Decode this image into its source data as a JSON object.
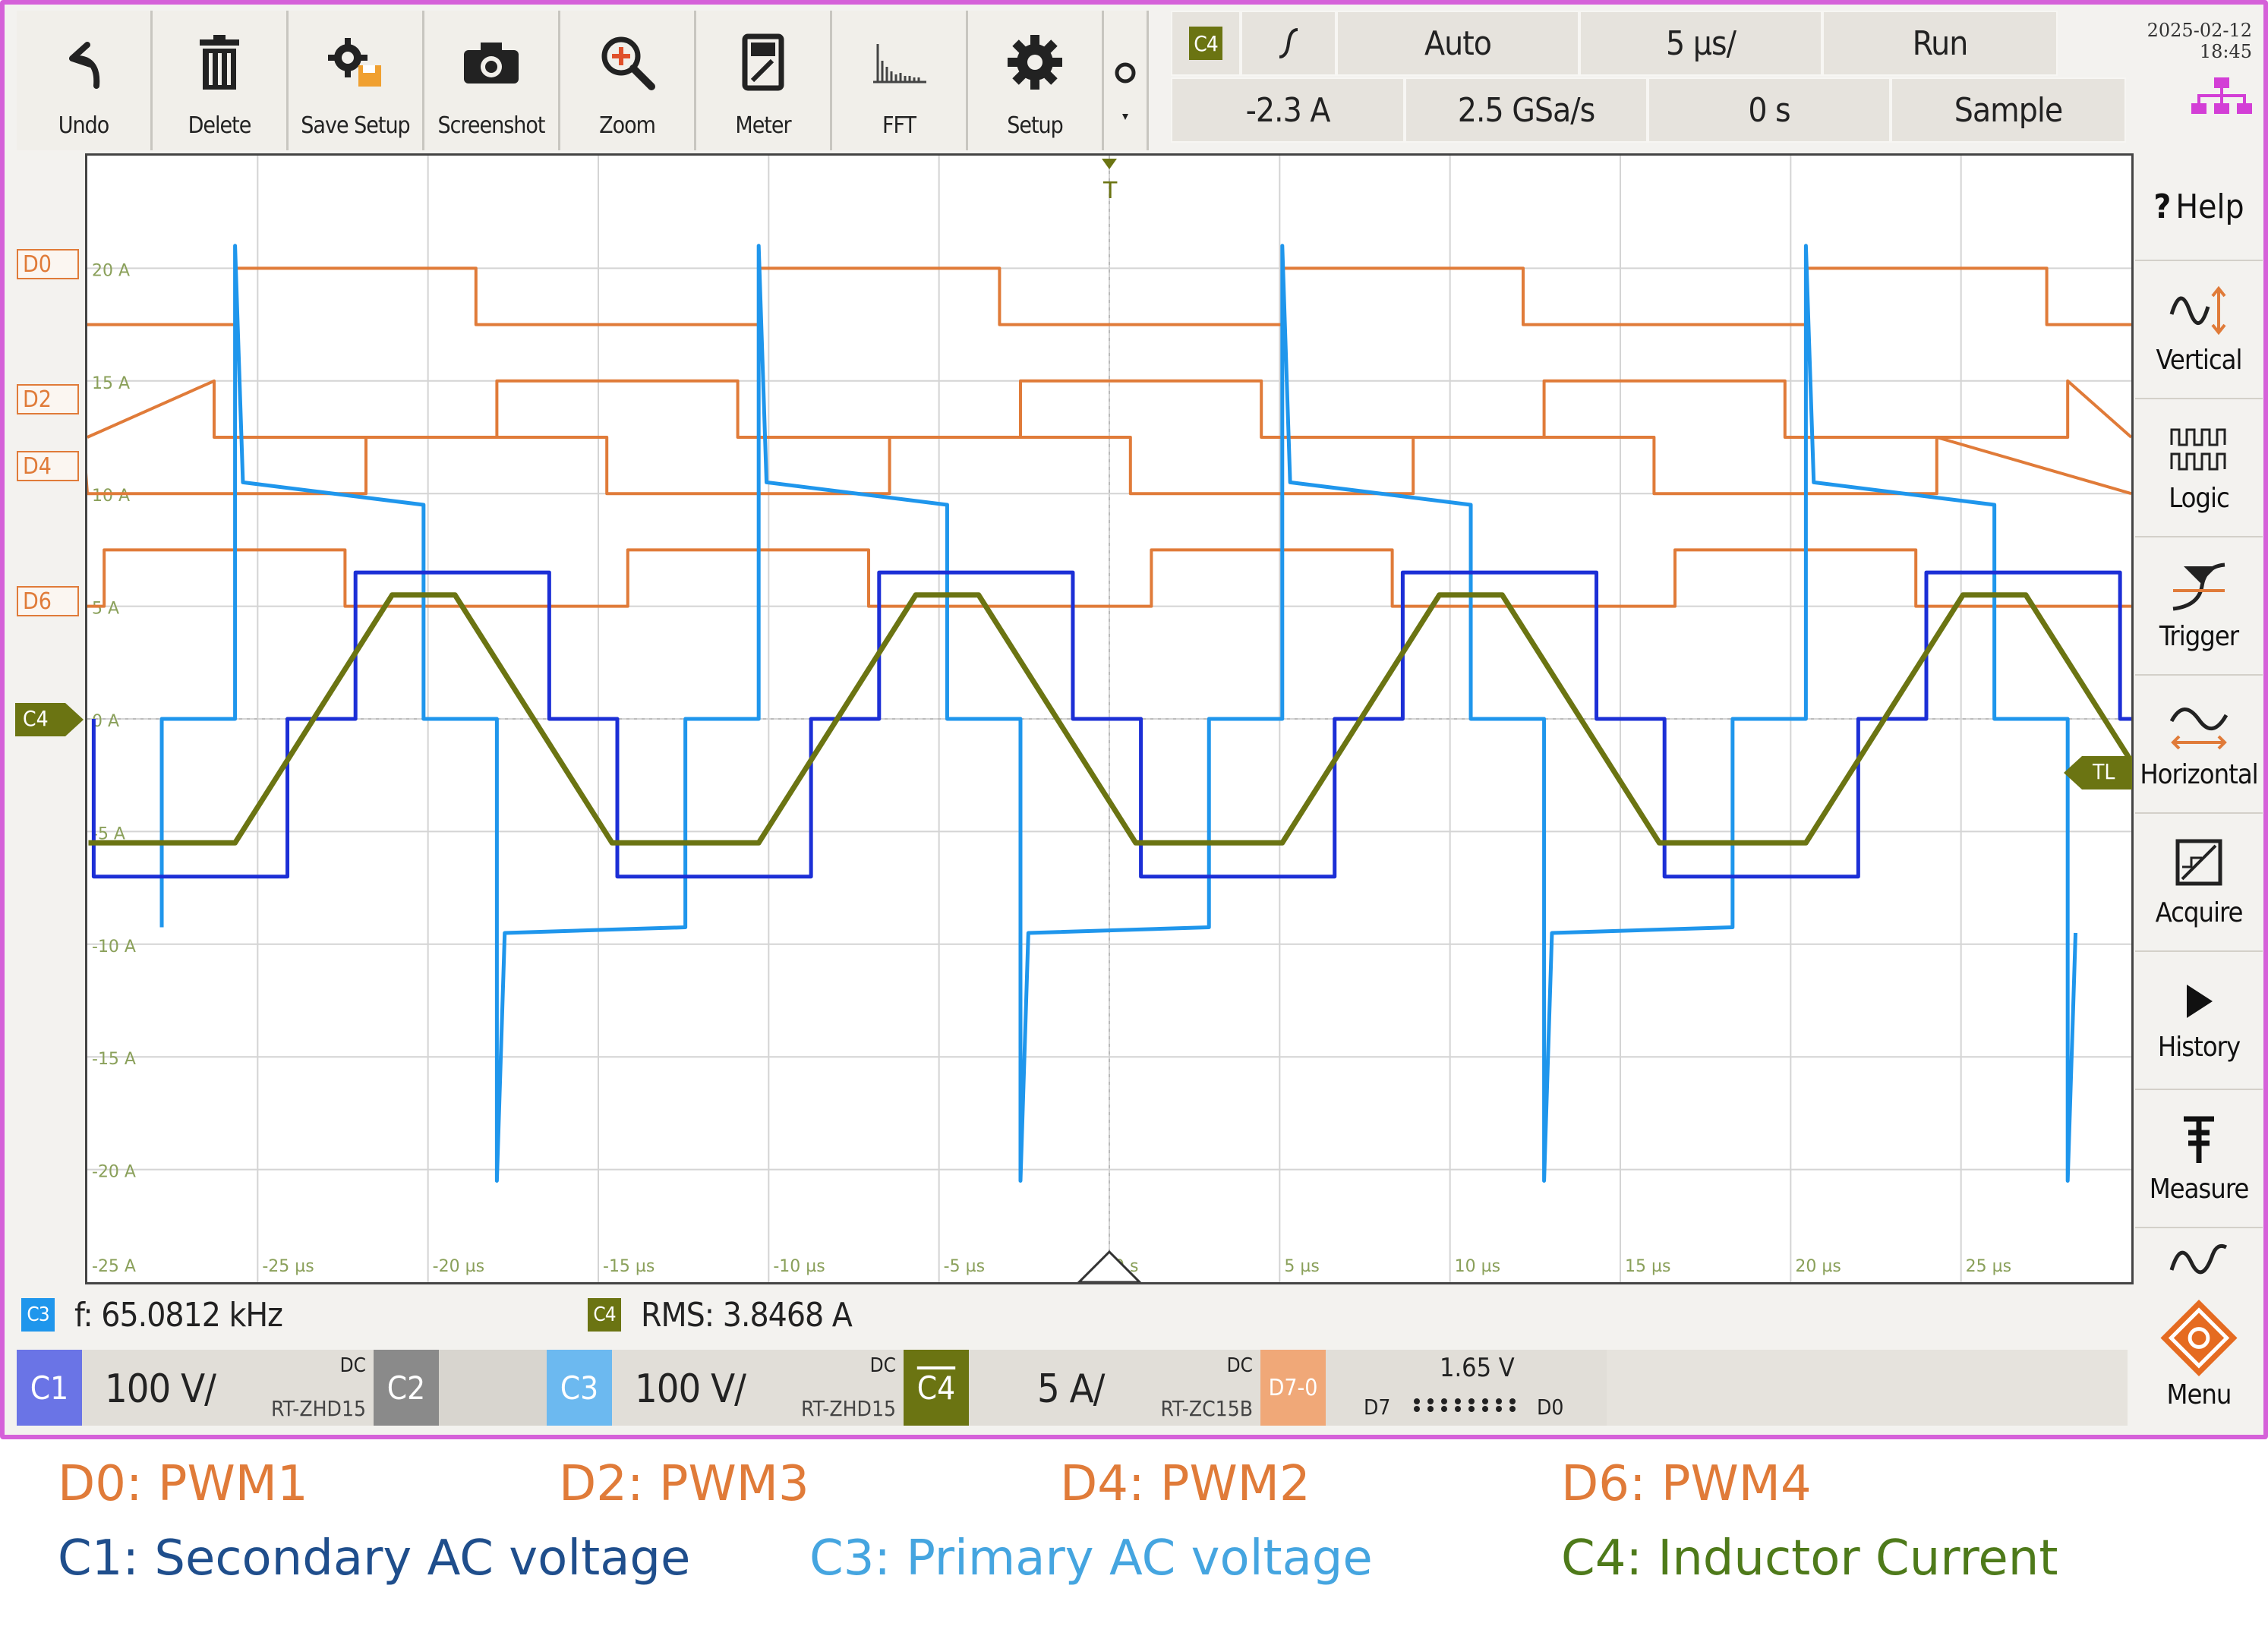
{
  "toolbar": {
    "buttons": [
      {
        "label": "Undo",
        "icon": "undo-icon"
      },
      {
        "label": "Delete",
        "icon": "trash-icon"
      },
      {
        "label": "Save Setup",
        "icon": "save-setup-icon"
      },
      {
        "label": "Screenshot",
        "icon": "camera-icon"
      },
      {
        "label": "Zoom",
        "icon": "zoom-icon"
      },
      {
        "label": "Meter",
        "icon": "meter-icon"
      },
      {
        "label": "FFT",
        "icon": "fft-icon"
      },
      {
        "label": "Setup",
        "icon": "gear-icon"
      }
    ]
  },
  "status": {
    "trigger_source": "C4",
    "trigger_level": "-2.3 A",
    "trigger_mode": "Auto",
    "sample_rate": "2.5 GSa/s",
    "time_scale": "5 µs/",
    "time_offset": "0 s",
    "run_state": "Run",
    "acq_mode": "Sample",
    "date": "2025-02-12",
    "time": "18:45"
  },
  "right_menu": [
    {
      "label": "Help",
      "icon": "help-icon"
    },
    {
      "label": "Vertical",
      "icon": "vertical-icon"
    },
    {
      "label": "Logic",
      "icon": "logic-icon"
    },
    {
      "label": "Trigger",
      "icon": "trigger-icon"
    },
    {
      "label": "Horizontal",
      "icon": "horizontal-icon"
    },
    {
      "label": "Acquire",
      "icon": "acquire-icon"
    },
    {
      "label": "History",
      "icon": "play-icon"
    },
    {
      "label": "Measure",
      "icon": "measure-icon"
    },
    {
      "label": "Menu",
      "icon": "rs-logo-icon"
    }
  ],
  "markers": {
    "digital": [
      "D0",
      "D2",
      "D4",
      "D6"
    ],
    "c4": "C4",
    "trigger_level": "TL",
    "trigger_pos": "T"
  },
  "plot": {
    "y_ticks": [
      "20 A",
      "15 A",
      "10 A",
      "5 A",
      "0 A",
      "-5 A",
      "-10 A",
      "-15 A",
      "-20 A",
      "-25 A"
    ],
    "x_ticks": [
      "-25 µs",
      "-20 µs",
      "-15 µs",
      "-10 µs",
      "-5 µs",
      "0 s",
      "5 µs",
      "10 µs",
      "15 µs",
      "20 µs",
      "25 µs"
    ],
    "colors": {
      "digital": "#e07b39",
      "c1": "#1c2fd6",
      "c3": "#1f96ec",
      "c4": "#6b7412",
      "grid": "#d4d4d4"
    }
  },
  "chart_data": {
    "type": "line",
    "xlabel": "",
    "ylabel": "",
    "xlim": [
      -30,
      30
    ],
    "ylim": [
      -25,
      25
    ],
    "period_us": 15.37,
    "series": [
      {
        "name": "C4: Inductor Current",
        "unit": "A",
        "peak": 5.5,
        "trough": -5.5
      },
      {
        "name": "C1: Secondary AC voltage",
        "scale": "100 V/div"
      },
      {
        "name": "C3: Primary AC voltage",
        "scale": "100 V/div"
      },
      {
        "name": "D0: PWM1"
      },
      {
        "name": "D2: PWM3"
      },
      {
        "name": "D4: PWM2"
      },
      {
        "name": "D6: PWM4"
      }
    ]
  },
  "measurements": {
    "freq": {
      "badge": "C3",
      "text": "f: 65.0812 kHz"
    },
    "rms": {
      "badge": "C4",
      "text": "RMS: 3.8468 A"
    }
  },
  "channels": {
    "c1": {
      "tag": "C1",
      "scale": "100 V/",
      "coupling": "DC",
      "probe": "RT-ZHD15"
    },
    "c2": {
      "tag": "C2"
    },
    "c3": {
      "tag": "C3",
      "scale": "100 V/",
      "coupling": "DC",
      "probe": "RT-ZHD15"
    },
    "c4": {
      "tag": "C4",
      "scale": "5 A/",
      "coupling": "DC",
      "probe": "RT-ZC15B"
    },
    "d70": {
      "tag": "D7-0",
      "level": "1.65 V",
      "from": "D7",
      "to": "D0"
    }
  },
  "legend": [
    {
      "text": "D0: PWM1",
      "color": "#e07b39"
    },
    {
      "text": "D2: PWM3",
      "color": "#e07b39"
    },
    {
      "text": "D4: PWM2",
      "color": "#e07b39"
    },
    {
      "text": "D6: PWM4",
      "color": "#e07b39"
    },
    {
      "text": "C1: Secondary AC voltage",
      "color": "#1f4e8c"
    },
    {
      "text": "C3: Primary AC voltage",
      "color": "#45a5e0"
    },
    {
      "text": "C4: Inductor Current",
      "color": "#4e7a1a"
    }
  ]
}
